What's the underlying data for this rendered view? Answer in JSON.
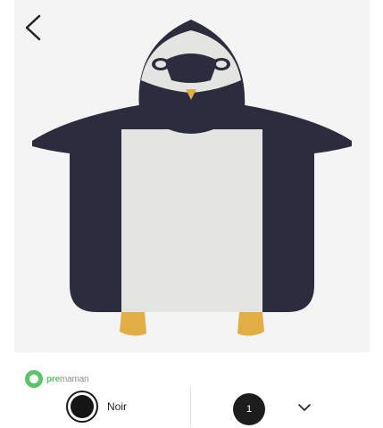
{
  "product": {
    "image_alt": "penguin-hooded-poncho",
    "colors": {
      "navy": "#2b2d3e",
      "cream": "#e4e4e1",
      "feet": "#e0ae45"
    }
  },
  "nav": {
    "back_icon": "chevron-left-icon"
  },
  "brand": {
    "name_primary": "pre",
    "name_secondary": "maman"
  },
  "options": {
    "color_label": "Noir",
    "swatch_color": "#151515",
    "quantity": "1",
    "quantity_icon": "chevron-down-icon"
  }
}
